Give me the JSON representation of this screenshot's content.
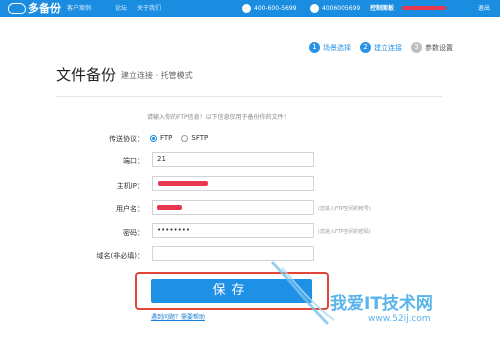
{
  "header": {
    "logo_text": "多备份",
    "nav": [
      "客户案例",
      "论坛",
      "关于我们"
    ],
    "phone1": "400-600-5699",
    "phone2": "4006005699",
    "control_panel": "控制面板",
    "logout": "退出"
  },
  "steps": [
    {
      "num": "1",
      "label": "场景选择",
      "state": "active"
    },
    {
      "num": "2",
      "label": "建立连接",
      "state": "active"
    },
    {
      "num": "3",
      "label": "参数设置",
      "state": "inactive"
    }
  ],
  "page": {
    "title": "文件备份",
    "subtitle": "建立连接 · 托管模式",
    "hint": "请输入你的FTP信息！以下信息仅用于备份你的文件！"
  },
  "form": {
    "protocol_label": "传送协议：",
    "protocol_options": [
      "FTP",
      "SFTP"
    ],
    "protocol_selected": "FTP",
    "port_label": "端口：",
    "port_value": "21",
    "host_label": "主机IP：",
    "user_label": "用户名：",
    "user_note": "(您进入FTP空间的帐号)",
    "password_label": "密码：",
    "password_value": "••••••••",
    "password_note": "(您进入FTP空间的密码)",
    "domain_label": "域名(非必填)：",
    "domain_value": ""
  },
  "actions": {
    "save_label": "保存",
    "help_link": "遇到问题？需要帮助"
  },
  "watermark": {
    "text": "我爱IT技术网",
    "url": "www.52ij.com"
  },
  "colors": {
    "topbar": "#1a8de0",
    "accent": "#1e90e6",
    "highlight": "#e0463a"
  }
}
